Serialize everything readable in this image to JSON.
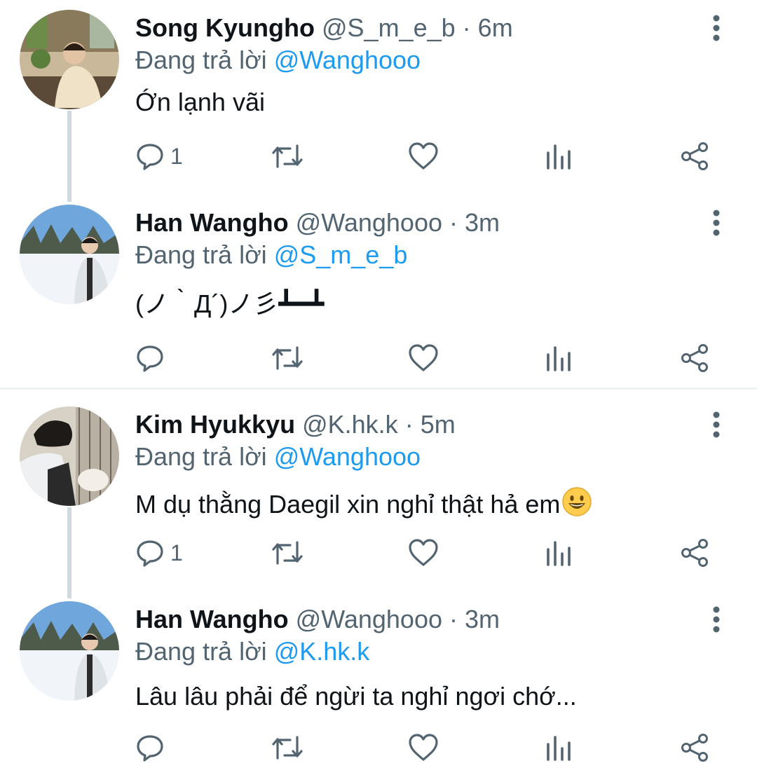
{
  "tweets": [
    {
      "name": "Song Kyungho",
      "handle": "@S_m_e_b",
      "time": "6m",
      "reply_prefix": "Đang trả lời",
      "reply_to": "@Wanghooo",
      "text": "Ớn lạnh vãi",
      "reply_count": "1"
    },
    {
      "name": "Han Wangho",
      "handle": "@Wanghooo",
      "time": "3m",
      "reply_prefix": "Đang trả lời",
      "reply_to": "@S_m_e_b",
      "text": "(ノ｀Д´)ノ彡┻━┻",
      "reply_count": ""
    },
    {
      "name": "Kim Hyukkyu",
      "handle": "@K.hk.k",
      "time": "5m",
      "reply_prefix": "Đang trả lời",
      "reply_to": "@Wanghooo",
      "text": "M dụ thằng Daegil xin nghỉ thật hả em",
      "emoji": "smiling-face-emoji",
      "reply_count": "1"
    },
    {
      "name": "Han Wangho",
      "handle": "@Wanghooo",
      "time": "3m",
      "reply_prefix": "Đang trả lời",
      "reply_to": "@K.hk.k",
      "text": "Lâu lâu phải để ngừi ta nghỉ ngơi chớ...",
      "reply_count": ""
    }
  ],
  "separator": "·",
  "icons": {
    "reply": "reply-icon",
    "retweet": "retweet-icon",
    "like": "heart-icon",
    "views": "analytics-icon",
    "share": "share-icon",
    "more": "more-vertical-icon"
  },
  "colors": {
    "text": "#0f1419",
    "secondary": "#536471",
    "link": "#1d9bf0",
    "thread_line": "#cfd9de",
    "divider": "#eff3f4"
  }
}
